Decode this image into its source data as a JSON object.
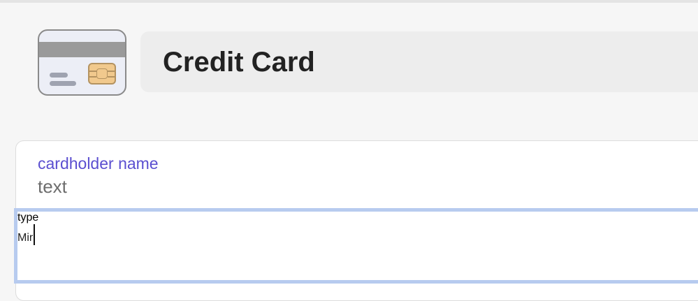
{
  "header": {
    "icon": "credit-card-icon",
    "title": "Credit Card"
  },
  "fields": {
    "cardholder_name": {
      "label": "cardholder name",
      "placeholder": "text"
    },
    "type": {
      "label": "type",
      "value": "Mir"
    }
  },
  "colors": {
    "label": "#5b4fd0",
    "focus_border": "#b7cbef",
    "title_bg": "#ededed"
  }
}
